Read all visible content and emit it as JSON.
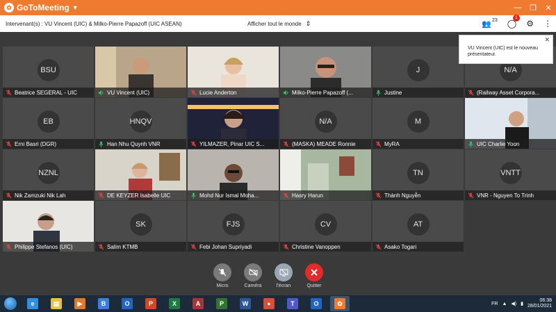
{
  "titlebar": {
    "app_name": "GoToMeeting",
    "minimize": "—",
    "restore": "❐",
    "close": "✕"
  },
  "topbar": {
    "speaker_text": "Intervenant(s) : VU Vincent (UIC) & Milko-Pierre Papazoff (UIC ASEAN)",
    "view_select": "Afficher tout le monde",
    "attendee_count": "23",
    "chat_badge": "1"
  },
  "notification": {
    "text": "VU Vincent (UIC) est le nouveau présentateur."
  },
  "participants": [
    {
      "initials": "BSU",
      "name": "Beatrice SEGERAL - UIC",
      "mic": "muted",
      "video": false
    },
    {
      "initials": "",
      "name": "VU Vincent (UIC)",
      "mic": "active",
      "video": true,
      "scene": "a"
    },
    {
      "initials": "",
      "name": "Lucie Anderton",
      "mic": "muted",
      "video": true,
      "scene": "b"
    },
    {
      "initials": "",
      "name": "Milko-Pierre Papazoff (...",
      "mic": "active",
      "video": true,
      "scene": "c"
    },
    {
      "initials": "J",
      "name": "Justine",
      "mic": "on",
      "video": false
    },
    {
      "initials": "N/A",
      "name": "(Railway Asset Corpora...",
      "mic": "muted",
      "video": false
    },
    {
      "initials": "EB",
      "name": "Erni Basri (DGR)",
      "mic": "muted",
      "video": false
    },
    {
      "initials": "HNQV",
      "name": "Han Nhu Quynh VNR",
      "mic": "on",
      "video": false
    },
    {
      "initials": "",
      "name": "YILMAZER, Pinar UIC S...",
      "mic": "muted",
      "video": true,
      "scene": "d"
    },
    {
      "initials": "N/A",
      "name": "(MASKA) MEADE Ronnie",
      "mic": "muted",
      "video": false
    },
    {
      "initials": "M",
      "name": "MyRA",
      "mic": "muted",
      "video": false
    },
    {
      "initials": "",
      "name": "UIC Charlie Yoon",
      "mic": "on",
      "video": true,
      "scene": "e"
    },
    {
      "initials": "NZNL",
      "name": "Nik Zamzuki Nik Lah",
      "mic": "muted",
      "video": false
    },
    {
      "initials": "",
      "name": "DE KEYZER Isabelle UIC",
      "mic": "muted",
      "video": true,
      "scene": "f"
    },
    {
      "initials": "",
      "name": "Mohd Nur Ismal Moha...",
      "mic": "on",
      "video": true,
      "scene": "g"
    },
    {
      "initials": "",
      "name": "Hasry Harun",
      "mic": "muted",
      "video": true,
      "scene": "h"
    },
    {
      "initials": "TN",
      "name": "Thành Nguyễn",
      "mic": "muted",
      "video": false
    },
    {
      "initials": "VNTT",
      "name": "VNR - Nguyen To Trinh",
      "mic": "muted",
      "video": false
    },
    {
      "initials": "",
      "name": "Philippe Stefanos (UIC)",
      "mic": "muted",
      "video": true,
      "scene": "i"
    },
    {
      "initials": "SK",
      "name": "Salim KTMB",
      "mic": "muted",
      "video": false
    },
    {
      "initials": "FJS",
      "name": "Febi Johan Supriyadi",
      "mic": "muted",
      "video": false
    },
    {
      "initials": "CV",
      "name": "Christine Vanoppen",
      "mic": "muted",
      "video": false
    },
    {
      "initials": "AT",
      "name": "Asako Togari",
      "mic": "muted",
      "video": false
    }
  ],
  "controls": {
    "micro": "Micro",
    "camera": "Caméra",
    "screen": "l'écran",
    "quit": "Quitter"
  },
  "taskbar": {
    "apps": [
      {
        "name": "ie",
        "glyph": "e",
        "color": "#2f8fe0"
      },
      {
        "name": "explorer",
        "glyph": "▤",
        "color": "#e8c04a"
      },
      {
        "name": "media",
        "glyph": "▶",
        "color": "#e07a2a"
      },
      {
        "name": "b-app",
        "glyph": "B",
        "color": "#3d7fd6"
      },
      {
        "name": "outlook",
        "glyph": "O",
        "color": "#1f66c2"
      },
      {
        "name": "powerpoint",
        "glyph": "P",
        "color": "#d24726"
      },
      {
        "name": "excel",
        "glyph": "X",
        "color": "#1d7a43"
      },
      {
        "name": "access",
        "glyph": "A",
        "color": "#a4373a"
      },
      {
        "name": "project",
        "glyph": "P",
        "color": "#31752f"
      },
      {
        "name": "word",
        "glyph": "W",
        "color": "#2b5797"
      },
      {
        "name": "chrome",
        "glyph": "●",
        "color": "#dd4b39"
      },
      {
        "name": "teams",
        "glyph": "T",
        "color": "#5059c9"
      },
      {
        "name": "outlook2",
        "glyph": "O",
        "color": "#1f66c2"
      },
      {
        "name": "gotomeeting",
        "glyph": "✿",
        "color": "#f07a2f"
      }
    ],
    "lang": "FR",
    "time": "06:38",
    "date": "28/01/2021"
  },
  "colors": {
    "brand": "#f07a2f",
    "muted": "#e24040",
    "active": "#36c26b"
  }
}
